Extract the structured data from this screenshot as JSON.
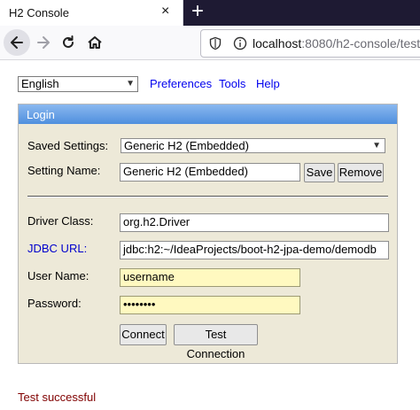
{
  "browser": {
    "tab_title": "H2 Console",
    "tab_close": "×",
    "new_tab": "+",
    "url_host": "localhost",
    "url_rest": ":8080/h2-console/test.do"
  },
  "toolbar": {
    "language_value": "English",
    "preferences": "Preferences",
    "tools": "Tools",
    "help": "Help"
  },
  "login": {
    "title": "Login",
    "saved_settings_label": "Saved Settings:",
    "saved_settings_value": "Generic H2 (Embedded)",
    "setting_name_label": "Setting Name:",
    "setting_name_value": "Generic H2 (Embedded)",
    "save": "Save",
    "remove": "Remove",
    "driver_class_label": "Driver Class:",
    "driver_class_value": "org.h2.Driver",
    "jdbc_url_label": "JDBC URL:",
    "jdbc_url_value": "jdbc:h2:~/IdeaProjects/boot-h2-jpa-demo/demodb",
    "user_name_label": "User Name:",
    "user_name_value": "username",
    "password_label": "Password:",
    "password_value": "••••••••",
    "connect": "Connect",
    "test_connection": "Test Connection"
  },
  "status": "Test successful",
  "colors": {
    "header_top": "#8ab8ef",
    "header_bottom": "#4f8fde",
    "panel_bg": "#ede9d8",
    "autofill_bg": "#fff9c0",
    "link": "#0000ee",
    "status_text": "#800000"
  },
  "icons": [
    "back-arrow-icon",
    "forward-arrow-icon",
    "reload-icon",
    "home-icon",
    "shield-icon",
    "info-icon",
    "chevron-down-icon"
  ]
}
